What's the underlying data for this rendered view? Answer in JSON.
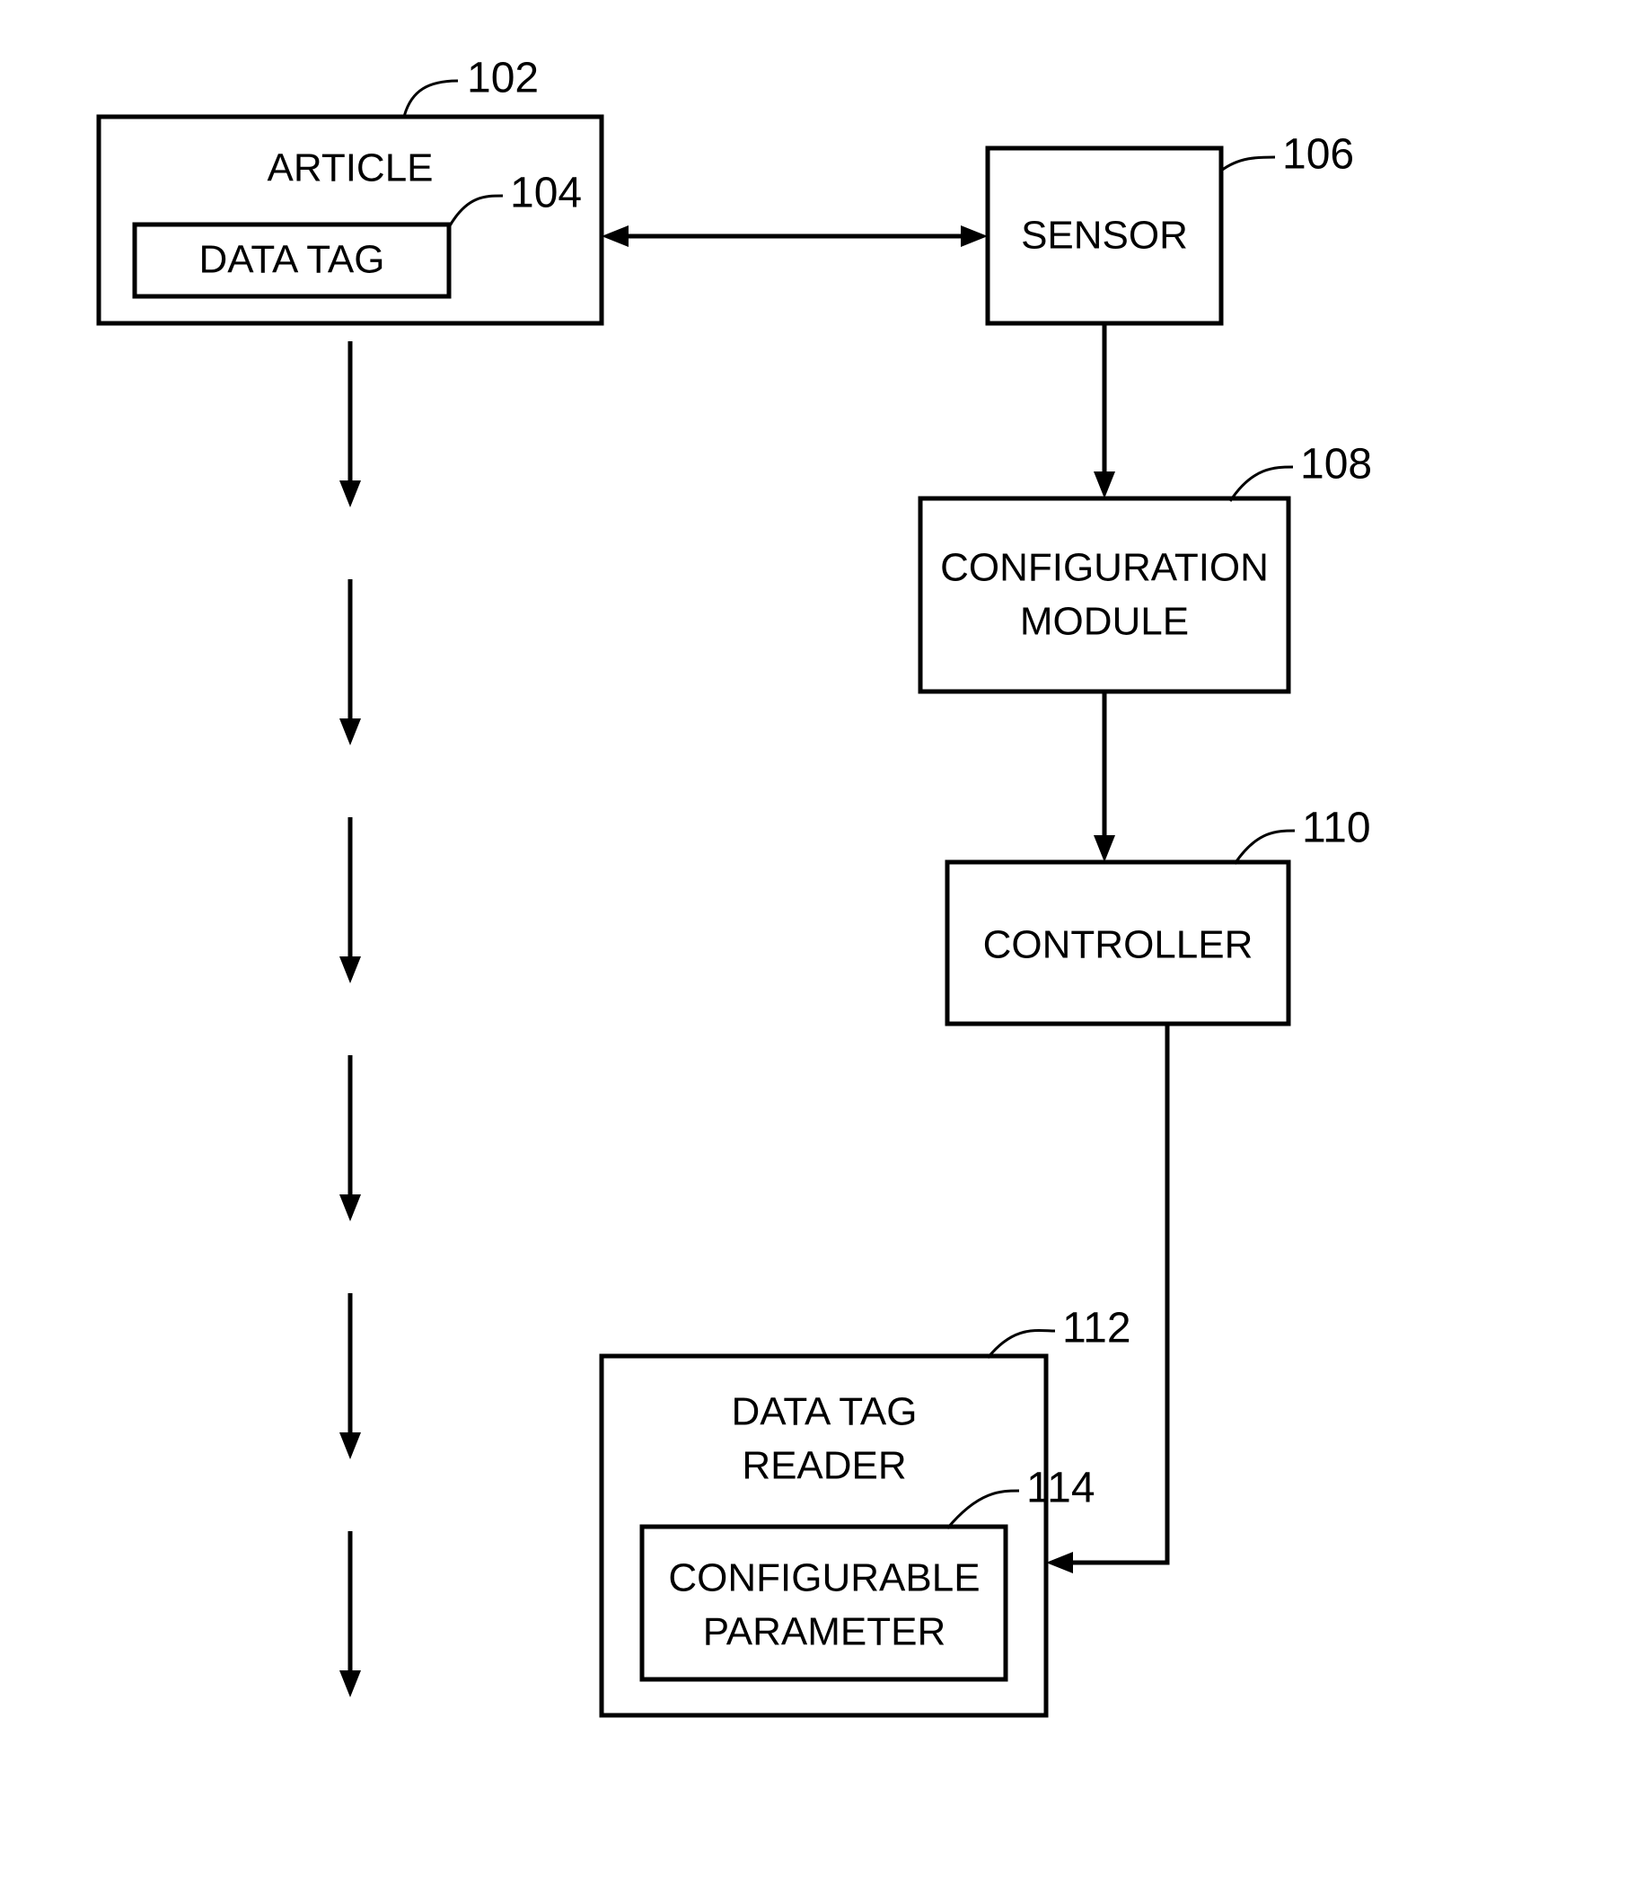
{
  "blocks": {
    "article": {
      "title": "ARTICLE",
      "ref": "102"
    },
    "datatag": {
      "title": "DATA TAG",
      "ref": "104"
    },
    "sensor": {
      "title": "SENSOR",
      "ref": "106"
    },
    "config": {
      "line1": "CONFIGURATION",
      "line2": "MODULE",
      "ref": "108"
    },
    "controller": {
      "title": "CONTROLLER",
      "ref": "110"
    },
    "reader": {
      "line1": "DATA TAG",
      "line2": "READER",
      "ref": "112"
    },
    "param": {
      "line1": "CONFIGURABLE",
      "line2": "PARAMETER",
      "ref": "114"
    }
  }
}
